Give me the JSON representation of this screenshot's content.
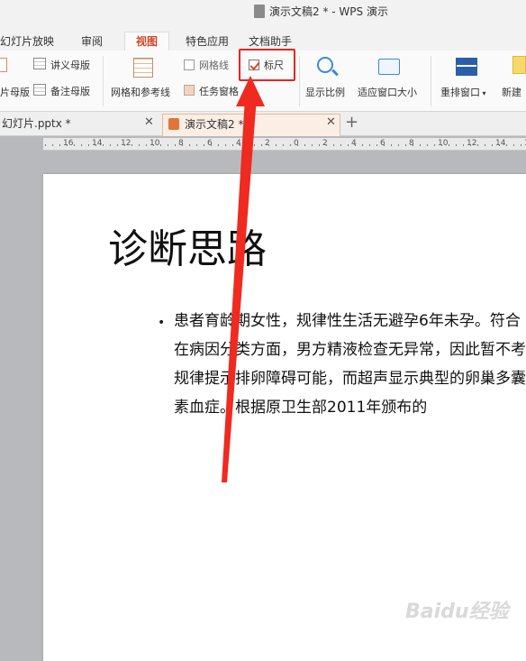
{
  "titlebar": {
    "title": "演示文稿2 * - WPS 演示"
  },
  "tabs": [
    {
      "label": "幻灯片放映"
    },
    {
      "label": "审阅"
    },
    {
      "label": "视图"
    },
    {
      "label": "特色应用"
    },
    {
      "label": "文档助手"
    }
  ],
  "ribbon": {
    "handout_master": "讲义母版",
    "slide_master_partial": "片母版",
    "notes_master": "备注母版",
    "grid_guides": "网格和参考线",
    "gridlines": "网格线",
    "ruler": "标尺",
    "task_pane": "任务窗格",
    "zoom": "显示比例",
    "fit_window": "适应窗口大小",
    "arrange_window": "重排窗口",
    "new_window_partial": "新建"
  },
  "state": {
    "ruler_checked": true,
    "gridlines_checked": false
  },
  "doctabs": [
    {
      "label": "幻灯片.pptx *"
    },
    {
      "label": "演示文稿2 *"
    }
  ],
  "ruler_numbers": [
    "16",
    "14",
    "12",
    "10",
    "8",
    "6",
    "4",
    "2",
    "0",
    "2",
    "4",
    "6",
    "8",
    "10",
    "12",
    "14",
    "16"
  ],
  "slide": {
    "title": "诊断思路",
    "lines": [
      "患者育龄期女性，规律性生活无避孕6年未孕。符合",
      "在病因分类方面，男方精液检查无异常，因此暂不考",
      "规律提示排卵障碍可能，而超声显示典型的卵巢多囊",
      "素血症。根据原卫生部2011年颁布的"
    ]
  },
  "watermark": "Baidu经验",
  "colors": {
    "accent": "#d24726",
    "highlight": "#e8251f"
  }
}
